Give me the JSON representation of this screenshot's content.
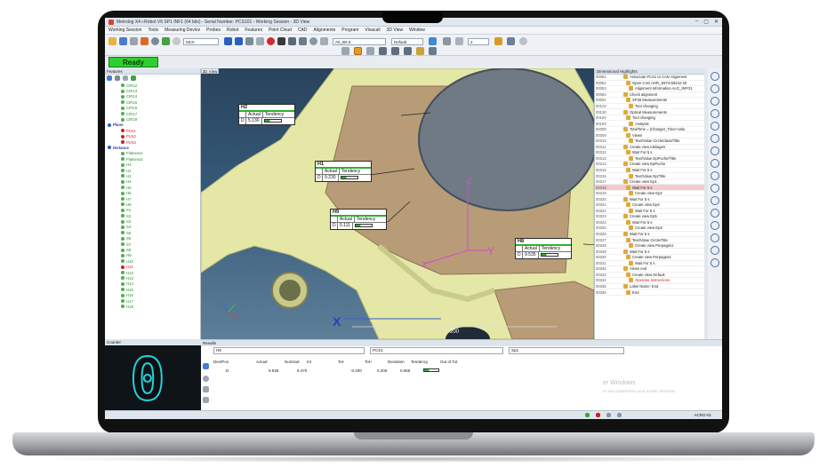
{
  "window": {
    "title": "Metrolog X4 i-Robot V6 SP1 INF1 (64 bits) - Serial Number: PCS101 - Working Session - 3D View",
    "controls": [
      "–",
      "▢",
      "✕"
    ]
  },
  "menu": [
    "Working Session",
    "Tools",
    "Measuring Device",
    "Probes",
    "Robot",
    "Features",
    "Point Cloud",
    "CAD",
    "Alignments",
    "Program",
    "Vivacali",
    "3D View",
    "Window"
  ],
  "toolbar": {
    "combo_probe": "MC0",
    "combo_feature": "A0_B0.0",
    "combo_view": "Default",
    "combo_scale": "2"
  },
  "status": {
    "ready": "Ready"
  },
  "left_panel": {
    "title": "Features",
    "items": [
      {
        "label": "CIR12",
        "type": "feat"
      },
      {
        "label": "CIR13",
        "type": "feat"
      },
      {
        "label": "CIR14",
        "type": "feat"
      },
      {
        "label": "CIR15",
        "type": "feat"
      },
      {
        "label": "CIR16",
        "type": "feat"
      },
      {
        "label": "CIR17",
        "type": "feat"
      },
      {
        "label": "CIR18",
        "type": "feat"
      },
      {
        "label": "Plane",
        "type": "grp"
      },
      {
        "label": "PLN1",
        "type": "red"
      },
      {
        "label": "PLN2",
        "type": "red"
      },
      {
        "label": "PLN3",
        "type": "red"
      },
      {
        "label": "Distance",
        "type": "grp"
      },
      {
        "label": "Flatness1",
        "type": "feat"
      },
      {
        "label": "Flatness2",
        "type": "feat"
      },
      {
        "label": "H1",
        "type": "feat"
      },
      {
        "label": "H2",
        "type": "feat"
      },
      {
        "label": "H3",
        "type": "feat"
      },
      {
        "label": "H4",
        "type": "feat"
      },
      {
        "label": "H5",
        "type": "feat"
      },
      {
        "label": "H6",
        "type": "feat"
      },
      {
        "label": "H7",
        "type": "feat"
      },
      {
        "label": "H8",
        "type": "feat"
      },
      {
        "label": "S1",
        "type": "feat"
      },
      {
        "label": "S2",
        "type": "feat"
      },
      {
        "label": "S3",
        "type": "feat"
      },
      {
        "label": "S4",
        "type": "feat"
      },
      {
        "label": "S5",
        "type": "feat"
      },
      {
        "label": "S6",
        "type": "feat"
      },
      {
        "label": "S7",
        "type": "feat"
      },
      {
        "label": "S8",
        "type": "feat"
      },
      {
        "label": "H9",
        "type": "feat"
      },
      {
        "label": "H10",
        "type": "feat"
      },
      {
        "label": "H11",
        "type": "red"
      },
      {
        "label": "H12",
        "type": "feat"
      },
      {
        "label": "H13",
        "type": "feat"
      },
      {
        "label": "H14",
        "type": "feat"
      },
      {
        "label": "H15",
        "type": "feat"
      },
      {
        "label": "H16",
        "type": "feat"
      },
      {
        "label": "H17",
        "type": "feat"
      },
      {
        "label": "H18",
        "type": "feat"
      }
    ]
  },
  "view3d": {
    "tab": "3D View",
    "axis_labels": {
      "x": "X",
      "y": "Y",
      "z": "Z"
    },
    "scale_value": "200",
    "callouts": [
      {
        "name": "H2",
        "actual_label": "Actual",
        "tendency_label": "Tendency",
        "row_prefix": "D",
        "value": "5.130"
      },
      {
        "name": "H1",
        "actual_label": "Actual",
        "tendency_label": "Tendency",
        "row_prefix": "D",
        "value": "9.230"
      },
      {
        "name": "H9",
        "actual_label": "Actual",
        "tendency_label": "Tendency",
        "row_prefix": "D",
        "value": "5.111"
      },
      {
        "name": "H8",
        "actual_label": "Actual",
        "tendency_label": "Tendency",
        "row_prefix": "D",
        "value": "9.535"
      }
    ]
  },
  "right_panel": {
    "title": "Dimensional Highlights",
    "rows": [
      {
        "num": "00081",
        "text": "Associate PCS1 to CAD Alignment"
      },
      {
        "num": "00082",
        "text": "Open CAD AHR_S974-60442-20"
      },
      {
        "num": "00083",
        "text": "Alignment Information ALG_INFO1"
      },
      {
        "num": "00084",
        "text": "Check alignment"
      },
      {
        "num": "00091",
        "text": "SP28 Measurements"
      },
      {
        "num": "00123",
        "text": "Tool changing"
      },
      {
        "num": "00130",
        "text": "Optical Measurements"
      },
      {
        "num": "00192",
        "text": "Tool changing"
      },
      {
        "num": "00193",
        "text": "Analysis"
      },
      {
        "num": "00308",
        "text": "TotalTime = (Changer_Time+Valu"
      },
      {
        "num": "00309",
        "text": "Views"
      },
      {
        "num": "00310",
        "text": "Text/Value CircleClass/Title"
      },
      {
        "num": "00311",
        "text": "Create view Ideliages"
      },
      {
        "num": "00312",
        "text": "Wait For 5 s"
      },
      {
        "num": "00313",
        "text": "Text/Value EpPoche/Title"
      },
      {
        "num": "00314",
        "text": "Create view EpPoche"
      },
      {
        "num": "00315",
        "text": "Wait For 5 s"
      },
      {
        "num": "00316",
        "text": "Text/Value Ep/Title"
      },
      {
        "num": "00317",
        "text": "Create view Ep1"
      },
      {
        "num": "00318",
        "text": "Wait For 5 s",
        "hl": true
      },
      {
        "num": "00319",
        "text": "Create view Ep2"
      },
      {
        "num": "00320",
        "text": "Wait For 5 s"
      },
      {
        "num": "00321",
        "text": "Create view Ep4"
      },
      {
        "num": "00322",
        "text": "Wait For 5 s"
      },
      {
        "num": "00323",
        "text": "Create view Ep5"
      },
      {
        "num": "00324",
        "text": "Wait For 5 s"
      },
      {
        "num": "00325",
        "text": "Create view Ep3"
      },
      {
        "num": "00326",
        "text": "Wait For 5 s"
      },
      {
        "num": "00327",
        "text": "Text/Value CircleiTitle"
      },
      {
        "num": "00328",
        "text": "Create view Perpages1"
      },
      {
        "num": "00329",
        "text": "Wait For 5 s"
      },
      {
        "num": "00330",
        "text": "Create view Perpages2"
      },
      {
        "num": "00331",
        "text": "Wait For 5 s"
      },
      {
        "num": "00332",
        "text": "Views end"
      },
      {
        "num": "00333",
        "text": "Create view Default"
      },
      {
        "num": "00334",
        "text": "Operator Instructions",
        "red": true
      },
      {
        "num": "00335",
        "text": "Label Name: End"
      },
      {
        "num": "00336",
        "text": "End"
      }
    ]
  },
  "counter": {
    "title": "Counter",
    "value": "0"
  },
  "results": {
    "title": "Results",
    "feature_combo": "H8",
    "frame_combo": "PCS1",
    "probe_combo": "Sp1",
    "headers": [
      "Dev/Pos",
      "Actual",
      "Nominal",
      "Int",
      "Tol-",
      "Tol+",
      "Deviation",
      "Tendency",
      "Out of Tol."
    ],
    "row": [
      "D",
      "9.535",
      "9.470",
      "",
      "-0.200",
      "0.200",
      "0.065",
      "",
      ""
    ],
    "watermark": "er Windows",
    "watermark_sub": "ez aux paramètres pour activer Windows"
  },
  "statusbar": {
    "right_text": "ACRO-01"
  }
}
